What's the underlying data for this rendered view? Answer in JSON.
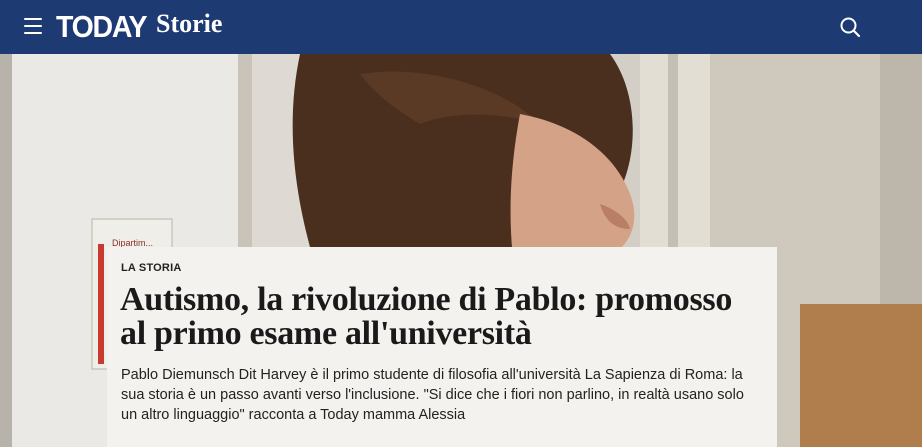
{
  "header": {
    "brand": "TODAY",
    "section": "Storie",
    "menu_icon": "hamburger-menu-icon",
    "search_icon": "search-icon",
    "background_color": "#1d3a73"
  },
  "article": {
    "category": "LA STORIA",
    "headline": "Autismo, la rivoluzione di Pablo: promosso al primo esame all'università",
    "summary": "Pablo Diemunsch Dit Harvey è il primo studente di filosofia all'università La Sapienza di Roma: la sua storia è un passo avanti verso l'inclusione. \"Si dice che i fiori non parlino, in realtà usano solo un altro linguaggio\" racconta a Today mamma Alessia"
  },
  "hero_image": {
    "subject": "young man in profile with curly hair",
    "sign_text": "Dipartim..."
  }
}
